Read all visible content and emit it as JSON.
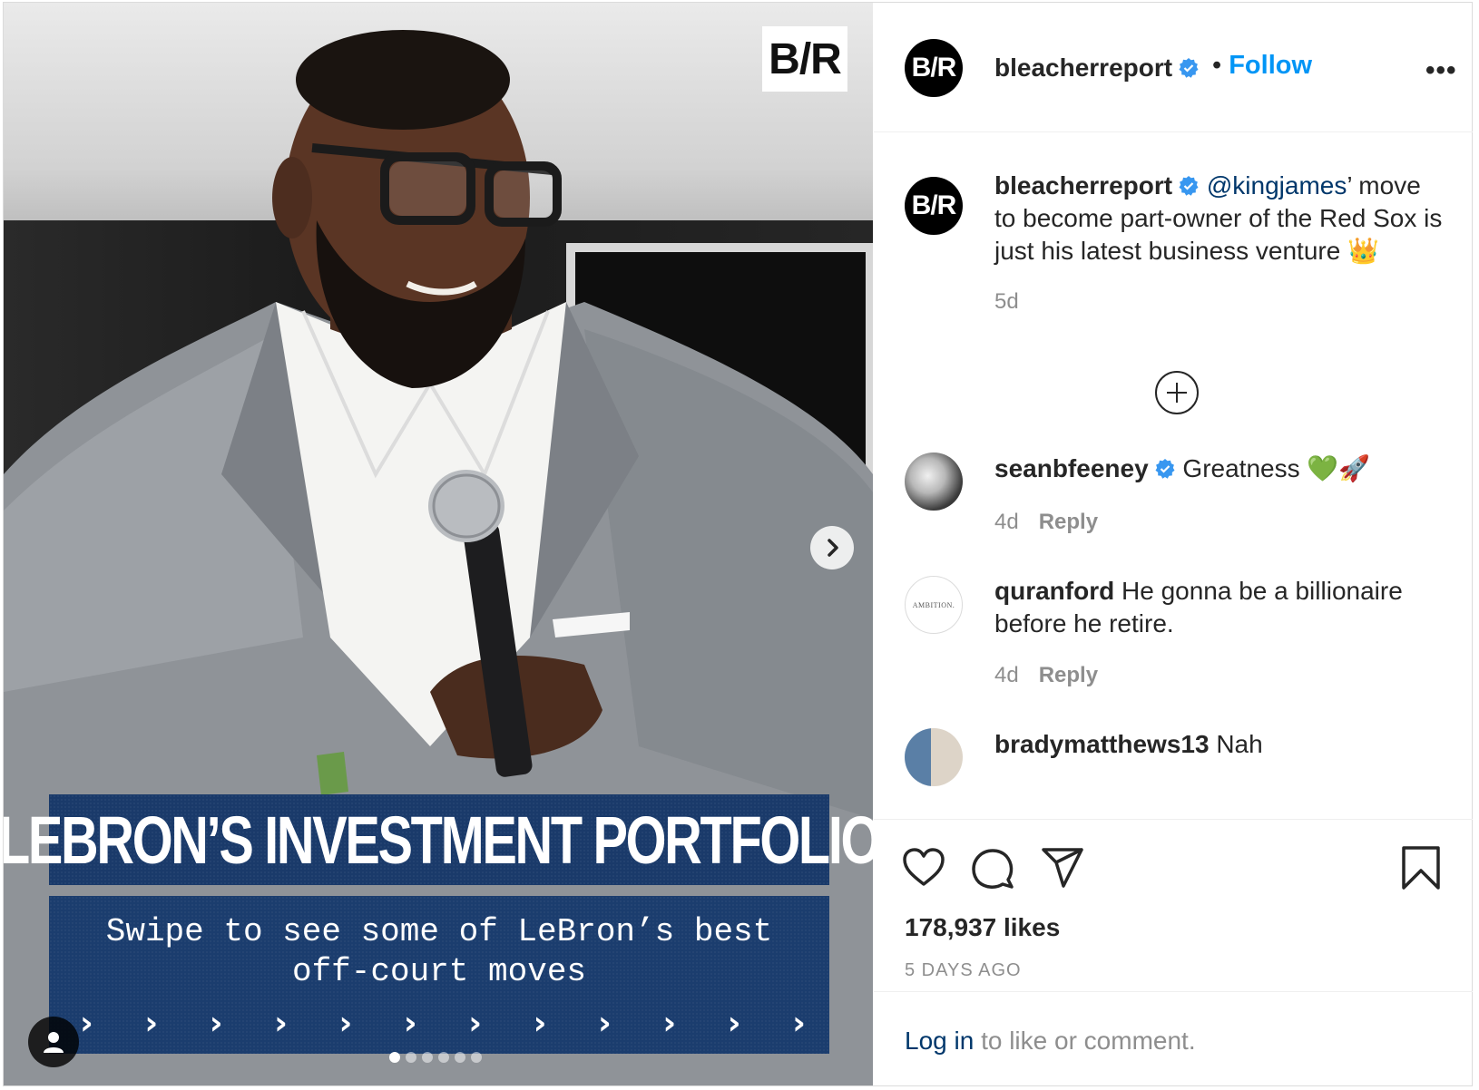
{
  "media": {
    "logo": "B/R",
    "banner_title": "LEBRON’S INVESTMENT PORTFOLIO",
    "banner_subtitle": "Swipe to see some of LeBron’s best off-court moves",
    "chevron": "›",
    "carousel": {
      "total": 6,
      "active_index": 0
    }
  },
  "header": {
    "avatar_text": "B/R",
    "username": "bleacherreport",
    "separator": "•",
    "follow_label": "Follow",
    "more_label": "•••"
  },
  "caption": {
    "avatar_text": "B/R",
    "username": "bleacherreport",
    "mention": "@kingjames",
    "text": "’ move to become part-owner of the Red Sox is just his latest business venture 👑",
    "time": "5d"
  },
  "comments": [
    {
      "username": "seanbfeeney",
      "verified": true,
      "text": "Greatness 💚🚀",
      "time": "4d",
      "reply": "Reply"
    },
    {
      "username": "quranford",
      "verified": false,
      "text": "He gonna be a billionaire before he retire.",
      "time": "4d",
      "reply": "Reply",
      "avatar_text": "AMBITION."
    },
    {
      "username": "bradymatthews13",
      "verified": false,
      "text": "Nah"
    }
  ],
  "actions": {
    "likes": "178,937 likes",
    "posted": "5 DAYS AGO"
  },
  "login": {
    "link": "Log in",
    "text": " to like or comment."
  },
  "colors": {
    "verified": "#3897f0",
    "link": "#0095f6",
    "banner": "#1b3d6e",
    "ray_green": "#2b8a3e"
  }
}
